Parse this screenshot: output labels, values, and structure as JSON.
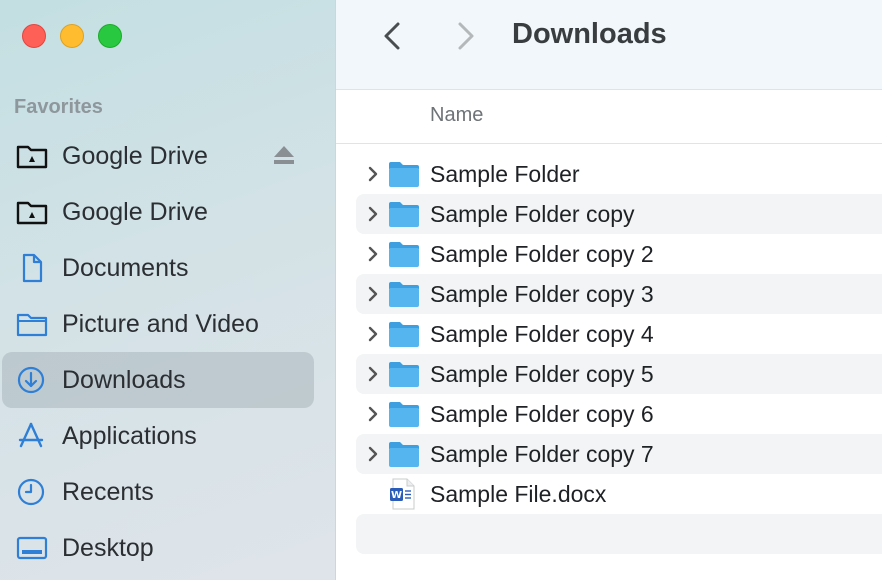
{
  "window": {
    "title": "Downloads"
  },
  "sidebar": {
    "section_heading": "Favorites",
    "items": [
      {
        "label": "Google Drive",
        "icon": "drive-folder-icon",
        "eject": true,
        "active": false
      },
      {
        "label": "Google Drive",
        "icon": "drive-folder-icon",
        "eject": false,
        "active": false
      },
      {
        "label": "Documents",
        "icon": "document-icon",
        "eject": false,
        "active": false
      },
      {
        "label": "Picture and Video",
        "icon": "folder-icon",
        "eject": false,
        "active": false
      },
      {
        "label": "Downloads",
        "icon": "download-icon",
        "eject": false,
        "active": true
      },
      {
        "label": "Applications",
        "icon": "applications-icon",
        "eject": false,
        "active": false
      },
      {
        "label": "Recents",
        "icon": "clock-icon",
        "eject": false,
        "active": false
      },
      {
        "label": "Desktop",
        "icon": "desktop-icon",
        "eject": false,
        "active": false
      }
    ]
  },
  "list": {
    "column_name": "Name",
    "rows": [
      {
        "name": "Sample Folder",
        "kind": "folder"
      },
      {
        "name": "Sample Folder copy",
        "kind": "folder"
      },
      {
        "name": "Sample Folder copy 2",
        "kind": "folder"
      },
      {
        "name": "Sample Folder copy 3",
        "kind": "folder"
      },
      {
        "name": "Sample Folder copy 4",
        "kind": "folder"
      },
      {
        "name": "Sample Folder copy 5",
        "kind": "folder"
      },
      {
        "name": "Sample Folder copy 6",
        "kind": "folder"
      },
      {
        "name": "Sample Folder copy 7",
        "kind": "folder"
      },
      {
        "name": "Sample File.docx",
        "kind": "word-document"
      }
    ]
  },
  "colors": {
    "accent": "#2f7fd6",
    "folder_blue": "#4aaee8",
    "close": "#fe5f57",
    "minimize": "#febc2e",
    "maximize": "#28c840"
  }
}
